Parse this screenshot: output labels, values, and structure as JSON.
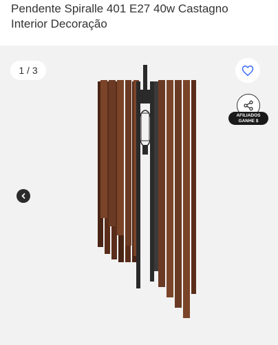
{
  "product": {
    "title_line1": "Pendente Spiralle 401  E27 40w Castagno",
    "title_line2": "Interior Decoração"
  },
  "gallery": {
    "counter": "1 / 3",
    "favorite_icon": "heart-icon",
    "share_icon": "share-icon",
    "affiliate_line1": "AFILIADOS",
    "affiliate_line2": "GANHE $",
    "prev_icon": "chevron-left-icon"
  },
  "colors": {
    "wood": "#6b3a24",
    "wood_dark": "#4a2414",
    "metal": "#2a2a2a",
    "heart_accent": "#3b6cf6"
  }
}
